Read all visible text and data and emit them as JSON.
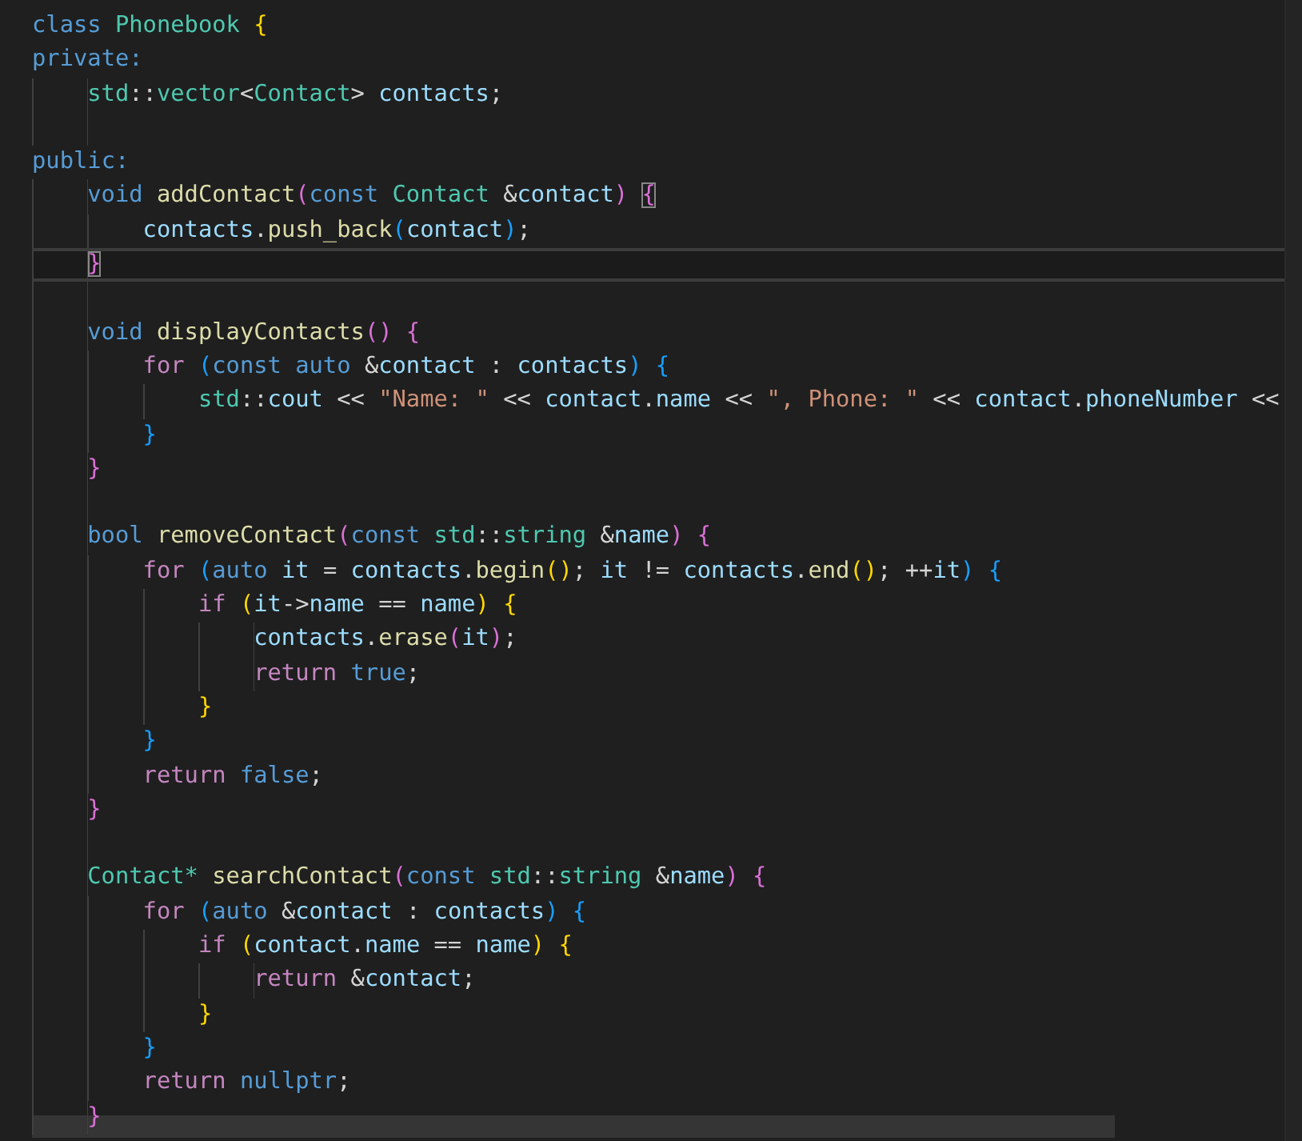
{
  "editor": {
    "lines": [
      {
        "current": false,
        "tokens": [
          {
            "text": "class ",
            "kind": "kw"
          },
          {
            "text": "Phonebook ",
            "kind": "type"
          },
          {
            "text": "{",
            "kind": "b1"
          }
        ]
      },
      {
        "current": false,
        "tokens": [
          {
            "text": "private:",
            "kind": "kw"
          }
        ]
      },
      {
        "current": false,
        "tokens": [
          {
            "text": "    std",
            "kind": "type"
          },
          {
            "text": "::",
            "kind": "p"
          },
          {
            "text": "vector",
            "kind": "type"
          },
          {
            "text": "<",
            "kind": "p"
          },
          {
            "text": "Contact",
            "kind": "type"
          },
          {
            "text": "> ",
            "kind": "p"
          },
          {
            "text": "contacts",
            "kind": "var"
          },
          {
            "text": ";",
            "kind": "p"
          }
        ]
      },
      {
        "kind": "blank"
      },
      {
        "current": false,
        "tokens": [
          {
            "text": "public:",
            "kind": "kw"
          }
        ]
      },
      {
        "current": false,
        "tokens": [
          {
            "text": "    void ",
            "kind": "kw"
          },
          {
            "text": "addContact",
            "kind": "fn"
          },
          {
            "text": "(",
            "kind": "b2"
          },
          {
            "text": "const ",
            "kind": "kw"
          },
          {
            "text": "Contact ",
            "kind": "type"
          },
          {
            "text": "&",
            "kind": "p"
          },
          {
            "text": "contact",
            "kind": "var"
          },
          {
            "text": ") ",
            "kind": "b2"
          },
          {
            "text": "{",
            "kind": "b2",
            "matched": true
          }
        ]
      },
      {
        "current": false,
        "tokens": [
          {
            "text": "        contacts",
            "kind": "var"
          },
          {
            "text": ".",
            "kind": "p"
          },
          {
            "text": "push_back",
            "kind": "fn"
          },
          {
            "text": "(",
            "kind": "b3"
          },
          {
            "text": "contact",
            "kind": "var"
          },
          {
            "text": ")",
            "kind": "b3"
          },
          {
            "text": ";",
            "kind": "p"
          }
        ]
      },
      {
        "current": true,
        "tokens": [
          {
            "text": "    }",
            "kind": "b2",
            "matched": true
          }
        ]
      },
      {
        "kind": "blank"
      },
      {
        "current": false,
        "tokens": [
          {
            "text": "    void ",
            "kind": "kw"
          },
          {
            "text": "displayContacts",
            "kind": "fn"
          },
          {
            "text": "() {",
            "kind": "b2"
          }
        ]
      },
      {
        "current": false,
        "tokens": [
          {
            "text": "        for ",
            "kind": "ctl"
          },
          {
            "text": "(",
            "kind": "b3"
          },
          {
            "text": "const auto ",
            "kind": "kw"
          },
          {
            "text": "&",
            "kind": "p"
          },
          {
            "text": "contact",
            "kind": "var"
          },
          {
            "text": " : ",
            "kind": "p"
          },
          {
            "text": "contacts",
            "kind": "var"
          },
          {
            "text": ") {",
            "kind": "b3"
          }
        ]
      },
      {
        "current": false,
        "tokens": [
          {
            "text": "            std",
            "kind": "type"
          },
          {
            "text": "::",
            "kind": "p"
          },
          {
            "text": "cout",
            "kind": "var"
          },
          {
            "text": " << ",
            "kind": "p"
          },
          {
            "text": "\"Name: \"",
            "kind": "str"
          },
          {
            "text": " << ",
            "kind": "p"
          },
          {
            "text": "contact",
            "kind": "var"
          },
          {
            "text": ".",
            "kind": "p"
          },
          {
            "text": "name",
            "kind": "var"
          },
          {
            "text": " << ",
            "kind": "p"
          },
          {
            "text": "\", Phone: \"",
            "kind": "str"
          },
          {
            "text": " << ",
            "kind": "p"
          },
          {
            "text": "contact",
            "kind": "var"
          },
          {
            "text": ".",
            "kind": "p"
          },
          {
            "text": "phoneNumber",
            "kind": "var"
          },
          {
            "text": " <<",
            "kind": "p"
          }
        ]
      },
      {
        "current": false,
        "tokens": [
          {
            "text": "        }",
            "kind": "b3"
          }
        ]
      },
      {
        "current": false,
        "tokens": [
          {
            "text": "    }",
            "kind": "b2"
          }
        ]
      },
      {
        "kind": "blank"
      },
      {
        "current": false,
        "tokens": [
          {
            "text": "    bool ",
            "kind": "kw"
          },
          {
            "text": "removeContact",
            "kind": "fn"
          },
          {
            "text": "(",
            "kind": "b2"
          },
          {
            "text": "const ",
            "kind": "kw"
          },
          {
            "text": "std",
            "kind": "type"
          },
          {
            "text": "::",
            "kind": "p"
          },
          {
            "text": "string ",
            "kind": "type"
          },
          {
            "text": "&",
            "kind": "p"
          },
          {
            "text": "name",
            "kind": "var"
          },
          {
            "text": ") {",
            "kind": "b2"
          }
        ]
      },
      {
        "current": false,
        "tokens": [
          {
            "text": "        for ",
            "kind": "ctl"
          },
          {
            "text": "(",
            "kind": "b3"
          },
          {
            "text": "auto ",
            "kind": "kw"
          },
          {
            "text": "it",
            "kind": "var"
          },
          {
            "text": " = ",
            "kind": "p"
          },
          {
            "text": "contacts",
            "kind": "var"
          },
          {
            "text": ".",
            "kind": "p"
          },
          {
            "text": "begin",
            "kind": "fn"
          },
          {
            "text": "()",
            "kind": "b1"
          },
          {
            "text": "; ",
            "kind": "p"
          },
          {
            "text": "it",
            "kind": "var"
          },
          {
            "text": " != ",
            "kind": "p"
          },
          {
            "text": "contacts",
            "kind": "var"
          },
          {
            "text": ".",
            "kind": "p"
          },
          {
            "text": "end",
            "kind": "fn"
          },
          {
            "text": "()",
            "kind": "b1"
          },
          {
            "text": "; ++",
            "kind": "p"
          },
          {
            "text": "it",
            "kind": "var"
          },
          {
            "text": ") {",
            "kind": "b3"
          }
        ]
      },
      {
        "current": false,
        "tokens": [
          {
            "text": "            if ",
            "kind": "ctl"
          },
          {
            "text": "(",
            "kind": "b1"
          },
          {
            "text": "it",
            "kind": "var"
          },
          {
            "text": "->",
            "kind": "p"
          },
          {
            "text": "name",
            "kind": "var"
          },
          {
            "text": " == ",
            "kind": "p"
          },
          {
            "text": "name",
            "kind": "var"
          },
          {
            "text": ") {",
            "kind": "b1"
          }
        ]
      },
      {
        "current": false,
        "tokens": [
          {
            "text": "                contacts",
            "kind": "var"
          },
          {
            "text": ".",
            "kind": "p"
          },
          {
            "text": "erase",
            "kind": "fn"
          },
          {
            "text": "(",
            "kind": "b2"
          },
          {
            "text": "it",
            "kind": "var"
          },
          {
            "text": ")",
            "kind": "b2"
          },
          {
            "text": ";",
            "kind": "p"
          }
        ]
      },
      {
        "current": false,
        "tokens": [
          {
            "text": "                return ",
            "kind": "ctl"
          },
          {
            "text": "true",
            "kind": "kw"
          },
          {
            "text": ";",
            "kind": "p"
          }
        ]
      },
      {
        "current": false,
        "tokens": [
          {
            "text": "            }",
            "kind": "b1"
          }
        ]
      },
      {
        "current": false,
        "tokens": [
          {
            "text": "        }",
            "kind": "b3"
          }
        ]
      },
      {
        "current": false,
        "tokens": [
          {
            "text": "        return ",
            "kind": "ctl"
          },
          {
            "text": "false",
            "kind": "kw"
          },
          {
            "text": ";",
            "kind": "p"
          }
        ]
      },
      {
        "current": false,
        "tokens": [
          {
            "text": "    }",
            "kind": "b2"
          }
        ]
      },
      {
        "kind": "blank"
      },
      {
        "current": false,
        "tokens": [
          {
            "text": "    Contact*",
            "kind": "type"
          },
          {
            "text": " searchContact",
            "kind": "fn"
          },
          {
            "text": "(",
            "kind": "b2"
          },
          {
            "text": "const ",
            "kind": "kw"
          },
          {
            "text": "std",
            "kind": "type"
          },
          {
            "text": "::",
            "kind": "p"
          },
          {
            "text": "string ",
            "kind": "type"
          },
          {
            "text": "&",
            "kind": "p"
          },
          {
            "text": "name",
            "kind": "var"
          },
          {
            "text": ") {",
            "kind": "b2"
          }
        ]
      },
      {
        "current": false,
        "tokens": [
          {
            "text": "        for ",
            "kind": "ctl"
          },
          {
            "text": "(",
            "kind": "b3"
          },
          {
            "text": "auto ",
            "kind": "kw"
          },
          {
            "text": "&",
            "kind": "p"
          },
          {
            "text": "contact",
            "kind": "var"
          },
          {
            "text": " : ",
            "kind": "p"
          },
          {
            "text": "contacts",
            "kind": "var"
          },
          {
            "text": ") {",
            "kind": "b3"
          }
        ]
      },
      {
        "current": false,
        "tokens": [
          {
            "text": "            if ",
            "kind": "ctl"
          },
          {
            "text": "(",
            "kind": "b1"
          },
          {
            "text": "contact",
            "kind": "var"
          },
          {
            "text": ".",
            "kind": "p"
          },
          {
            "text": "name",
            "kind": "var"
          },
          {
            "text": " == ",
            "kind": "p"
          },
          {
            "text": "name",
            "kind": "var"
          },
          {
            "text": ") {",
            "kind": "b1"
          }
        ]
      },
      {
        "current": false,
        "tokens": [
          {
            "text": "                return ",
            "kind": "ctl"
          },
          {
            "text": "&",
            "kind": "p"
          },
          {
            "text": "contact",
            "kind": "var"
          },
          {
            "text": ";",
            "kind": "p"
          }
        ]
      },
      {
        "current": false,
        "tokens": [
          {
            "text": "            }",
            "kind": "b1"
          }
        ]
      },
      {
        "current": false,
        "tokens": [
          {
            "text": "        }",
            "kind": "b3"
          }
        ]
      },
      {
        "current": false,
        "tokens": [
          {
            "text": "        return ",
            "kind": "ctl"
          },
          {
            "text": "nullptr",
            "kind": "kw"
          },
          {
            "text": ";",
            "kind": "p"
          }
        ]
      },
      {
        "current": false,
        "tokens": [
          {
            "text": "    }",
            "kind": "b2"
          }
        ]
      }
    ]
  }
}
